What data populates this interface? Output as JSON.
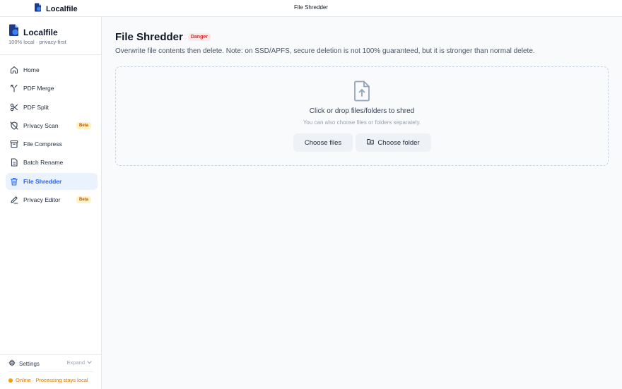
{
  "window": {
    "title": "File Shredder"
  },
  "app": {
    "name": "Localfile",
    "tagline": "100% local · privacy-first"
  },
  "sidebar": {
    "items": [
      {
        "label": "Home",
        "icon": "home-icon",
        "active": false
      },
      {
        "label": "PDF Merge",
        "icon": "merge-icon",
        "active": false
      },
      {
        "label": "PDF Split",
        "icon": "scissors-icon",
        "active": false
      },
      {
        "label": "Privacy Scan",
        "icon": "shield-off-icon",
        "active": false,
        "badge": "Beta"
      },
      {
        "label": "File Compress",
        "icon": "archive-icon",
        "active": false
      },
      {
        "label": "Batch Rename",
        "icon": "file-icon",
        "active": false
      },
      {
        "label": "File Shredder",
        "icon": "trash-icon",
        "active": true
      },
      {
        "label": "Privacy Editor",
        "icon": "pen-icon",
        "active": false,
        "badge": "Beta"
      }
    ],
    "settings_label": "Settings",
    "expand_label": "Expand",
    "status_text": "Online · Processing stays local"
  },
  "main": {
    "title": "File Shredder",
    "badge": "Danger",
    "description": "Overwrite file contents then delete. Note: on SSD/APFS, secure deletion is not 100% guaranteed, but it is stronger than normal delete.",
    "dropzone": {
      "title": "Click or drop files/folders to shred",
      "subtitle": "You can also choose files or folders separately.",
      "choose_files_label": "Choose files",
      "choose_folder_label": "Choose folder"
    }
  },
  "colors": {
    "accent": "#2563eb",
    "active_bg": "#eaf2fd",
    "danger": "#dc2626",
    "beta": "#b45309",
    "status": "#f59e0b",
    "brand": "#1d4ed8"
  }
}
